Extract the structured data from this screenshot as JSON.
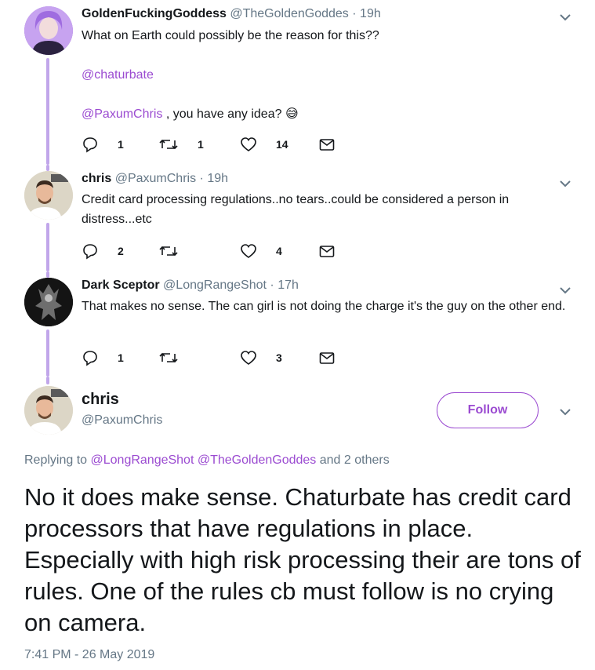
{
  "tweets": [
    {
      "name": "GoldenFuckingGoddess",
      "handle": "@TheGoldenGoddes",
      "sep": "·",
      "time": "19h",
      "line1": "What on Earth could possibly be the reason for this??",
      "mention1": "@chaturbate",
      "mention2": "@PaxumChris",
      "line3_rest": " , you have any idea? ",
      "emoji": "😅",
      "replies": "1",
      "retweets": "1",
      "likes": "14"
    },
    {
      "name": "chris",
      "handle": "@PaxumChris",
      "sep": "·",
      "time": "19h",
      "text": "Credit card processing regulations..no tears..could be considered a person in distress...etc",
      "replies": "2",
      "retweets": "",
      "likes": "4"
    },
    {
      "name": "Dark Sceptor",
      "handle": "@LongRangeShot",
      "sep": "·",
      "time": "17h",
      "text": "That makes no sense.  The can girl is not doing the charge it's the guy on the other end.",
      "replies": "1",
      "retweets": "",
      "likes": "3"
    }
  ],
  "main": {
    "name": "chris",
    "handle": "@PaxumChris",
    "follow_label": "Follow",
    "replying_prefix": "Replying to ",
    "replying_mention1": "@LongRangeShot",
    "replying_mention2": "@TheGoldenGoddes",
    "replying_suffix": " and 2 others",
    "text": "No it does make sense. Chaturbate has credit card processors that have regulations in place. Especially with high risk processing their are tons of rules. One of the rules cb must follow is no crying on camera.",
    "timestamp": "7:41 PM - 26 May 2019"
  },
  "icons": {
    "reply": "reply-icon",
    "retweet": "retweet-icon",
    "like": "heart-icon",
    "dm": "envelope-icon",
    "more": "chevron-down-icon"
  },
  "colors": {
    "accent": "#9b4bd1",
    "thread_line": "#c1a6ea",
    "muted": "#657786"
  }
}
